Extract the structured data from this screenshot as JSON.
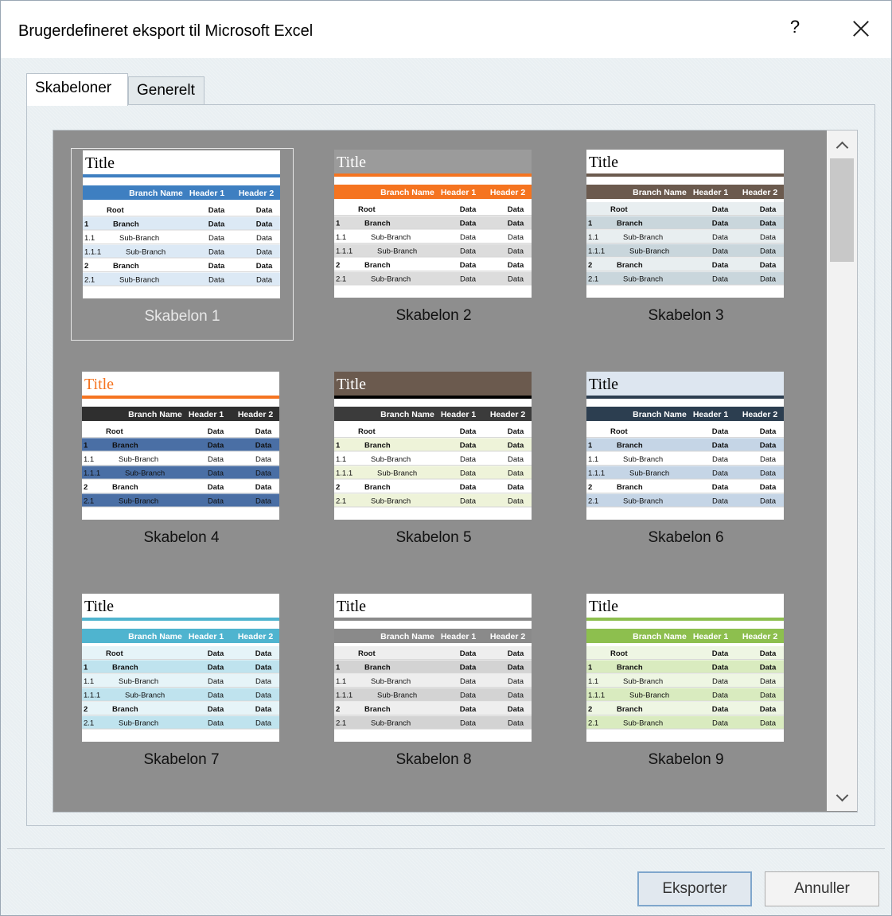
{
  "window": {
    "title": "Brugerdefineret eksport til Microsoft Excel",
    "help_label": "?"
  },
  "tabs": [
    {
      "label": "Skabeloner",
      "active": true
    },
    {
      "label": "Generelt",
      "active": false
    }
  ],
  "templates": [
    {
      "label": "Skabelon 1",
      "selected": true
    },
    {
      "label": "Skabelon 2",
      "selected": false
    },
    {
      "label": "Skabelon 3",
      "selected": false
    },
    {
      "label": "Skabelon 4",
      "selected": false
    },
    {
      "label": "Skabelon 5",
      "selected": false
    },
    {
      "label": "Skabelon 6",
      "selected": false
    },
    {
      "label": "Skabelon 7",
      "selected": false
    },
    {
      "label": "Skabelon 8",
      "selected": false
    },
    {
      "label": "Skabelon 9",
      "selected": false
    }
  ],
  "preview": {
    "title": "Title",
    "headers": [
      "Branch Name",
      "Header 1",
      "Header 2"
    ],
    "rows": [
      {
        "num": "",
        "name": "Root",
        "h1": "Data",
        "h2": "Data"
      },
      {
        "num": "1",
        "name": "Branch",
        "h1": "Data",
        "h2": "Data"
      },
      {
        "num": "1.1",
        "name": "Sub-Branch",
        "h1": "Data",
        "h2": "Data"
      },
      {
        "num": "1.1.1",
        "name": "Sub-Branch",
        "h1": "Data",
        "h2": "Data"
      },
      {
        "num": "2",
        "name": "Branch",
        "h1": "Data",
        "h2": "Data"
      },
      {
        "num": "2.1",
        "name": "Sub-Branch",
        "h1": "Data",
        "h2": "Data"
      }
    ]
  },
  "themes": [
    {
      "headerBg": "#3e7fc1",
      "headerFg": "#ffffff",
      "rowBg": "#dce9f5",
      "altBg": "#ffffff",
      "titleColor": "#000000",
      "titleBand": "#ffffff",
      "accent": "#3e7fc1"
    },
    {
      "headerBg": "#f57420",
      "headerFg": "#ffffff",
      "rowBg": "#dcdcdc",
      "altBg": "#ffffff",
      "titleColor": "#ffffff",
      "titleBand": "#9b9b9b",
      "accent": "#f57420"
    },
    {
      "headerBg": "#6b5a4e",
      "headerFg": "#ffffff",
      "rowBg": "#c9d6dc",
      "altBg": "#e8eef0",
      "titleColor": "#000000",
      "titleBand": "#ffffff",
      "accent": "#6b5a4e"
    },
    {
      "headerBg": "#2f2f2f",
      "headerFg": "#ffffff",
      "rowBg": "#4a6fa5",
      "altBg": "#ffffff",
      "titleColor": "#f57420",
      "titleBand": "#ffffff",
      "accent": "#f57420"
    },
    {
      "headerBg": "#3b3b3b",
      "headerFg": "#ffffff",
      "rowBg": "#eef3d9",
      "altBg": "#ffffff",
      "titleColor": "#ffffff",
      "titleBand": "#6b5a4e",
      "accent": "#000000"
    },
    {
      "headerBg": "#2c3e50",
      "headerFg": "#ffffff",
      "rowBg": "#c5d5e6",
      "altBg": "#ffffff",
      "titleColor": "#000000",
      "titleBand": "#dde6f0",
      "accent": "#2c3e50"
    },
    {
      "headerBg": "#4fb4cf",
      "headerFg": "#ffffff",
      "rowBg": "#bfe3ee",
      "altBg": "#e6f4f8",
      "titleColor": "#000000",
      "titleBand": "#ffffff",
      "accent": "#4fb4cf"
    },
    {
      "headerBg": "#8a8a8a",
      "headerFg": "#ffffff",
      "rowBg": "#d3d3d3",
      "altBg": "#eeeeee",
      "titleColor": "#000000",
      "titleBand": "#ffffff",
      "accent": "#8a8a8a"
    },
    {
      "headerBg": "#8dbf4e",
      "headerFg": "#ffffff",
      "rowBg": "#d9ebbf",
      "altBg": "#eef6e3",
      "titleColor": "#000000",
      "titleBand": "#ffffff",
      "accent": "#8dbf4e"
    }
  ],
  "buttons": {
    "export_label": "Eksporter",
    "cancel_label": "Annuller"
  }
}
